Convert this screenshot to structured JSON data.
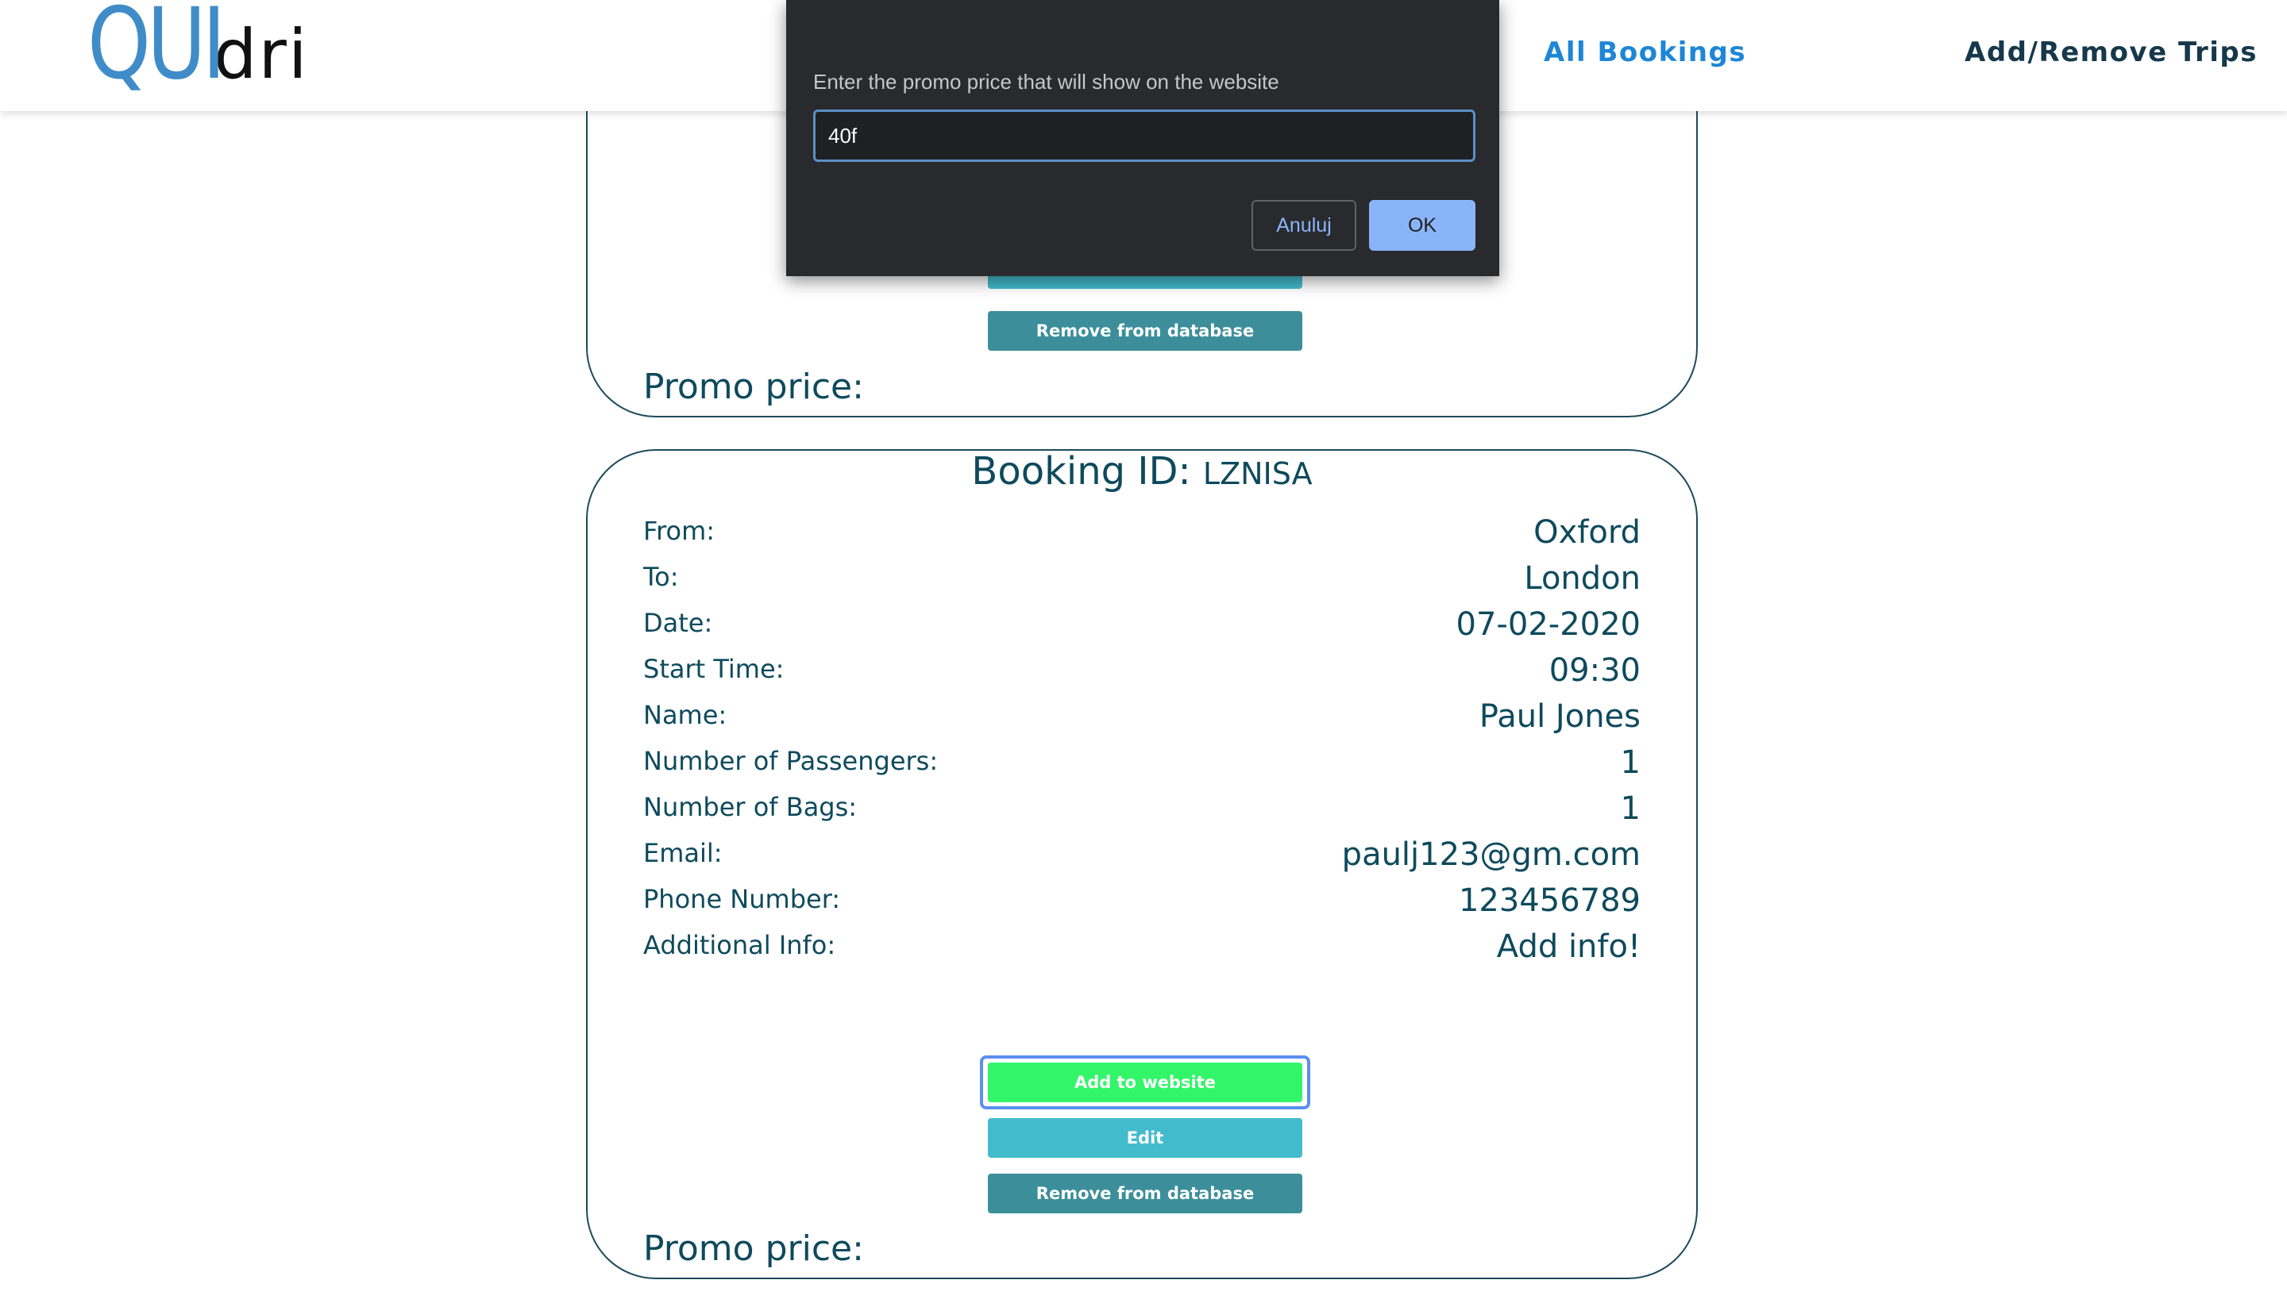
{
  "header": {
    "logo_part1": "QUI",
    "logo_part2": "dri",
    "nav_all_bookings": "All Bookings",
    "nav_add_remove_trips": "Add/Remove Trips"
  },
  "dialog": {
    "message": "Enter the promo price that will show on the website",
    "input_value": "40f",
    "cancel_label": "Anuluj",
    "ok_label": "OK"
  },
  "card_top": {
    "edit_label": "Edit",
    "remove_label": "Remove from database",
    "promo_label": "Promo price:"
  },
  "booking": {
    "title_label": "Booking ID:",
    "id": "LZNISA",
    "fields": [
      {
        "label": "From:",
        "value": "Oxford"
      },
      {
        "label": "To:",
        "value": "London"
      },
      {
        "label": "Date:",
        "value": "07-02-2020"
      },
      {
        "label": "Start Time:",
        "value": "09:30"
      },
      {
        "label": "Name:",
        "value": "Paul Jones"
      },
      {
        "label": "Number of Passengers:",
        "value": "1"
      },
      {
        "label": "Number of Bags:",
        "value": "1"
      },
      {
        "label": "Email:",
        "value": "paulj123@gm.com"
      },
      {
        "label": "Phone Number:",
        "value": "123456789"
      },
      {
        "label": "Additional Info:",
        "value": "Add info!"
      }
    ],
    "add_label": "Add to website",
    "edit_label": "Edit",
    "remove_label": "Remove from database",
    "promo_label": "Promo price:"
  }
}
